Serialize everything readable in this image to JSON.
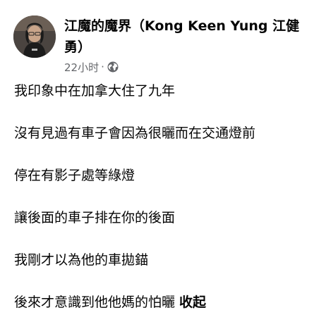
{
  "post": {
    "author": "江魔的魔界（Kong Keen Yung 江健勇）",
    "timestamp": "22小时",
    "separator": "·",
    "privacy_icon": "globe-icon",
    "lines": [
      "我印象中在加拿大住了九年",
      "沒有見過有車子會因為很曬而在交通燈前",
      "停在有影子處等綠燈",
      "讓後面的車子排在你的後面",
      "我剛才以為他的車拋錨",
      "後來才意識到他他媽的怕曬"
    ],
    "see_less": "收起"
  },
  "colors": {
    "text": "#050505",
    "secondary": "#65676b"
  }
}
